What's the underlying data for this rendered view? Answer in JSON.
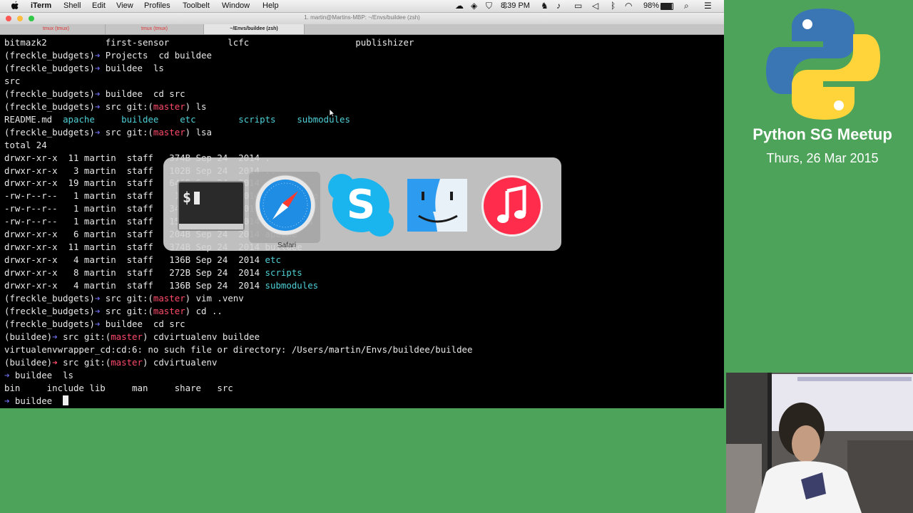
{
  "menubar": {
    "app_name": "iTerm",
    "menus": [
      "Shell",
      "Edit",
      "View",
      "Profiles",
      "Toolbelt",
      "Window",
      "Help"
    ],
    "time": "8:39 PM",
    "battery": "98%"
  },
  "window": {
    "title": "1. martin@Martins-MBP: ~/Envs/buildee (zsh)",
    "tabs": [
      "tmux (tmux)",
      "tmux (tmux)",
      "~/Envs/buildee (zsh)"
    ]
  },
  "terminal": {
    "lines": [
      [
        {
          "t": "bitmazk2           first-sensor           lcfc                    publishizer"
        }
      ],
      [
        {
          "t": "(freckle_budgets)"
        },
        {
          "t": "➜ ",
          "c": "c-arrow"
        },
        {
          "t": "Projects  cd buildee"
        }
      ],
      [
        {
          "t": "(freckle_budgets)"
        },
        {
          "t": "➜ ",
          "c": "c-arrow"
        },
        {
          "t": "buildee  ls"
        }
      ],
      [
        {
          "t": "src"
        }
      ],
      [
        {
          "t": "(freckle_budgets)"
        },
        {
          "t": "➜ ",
          "c": "c-arrow"
        },
        {
          "t": "buildee  cd src"
        }
      ],
      [
        {
          "t": "(freckle_budgets)"
        },
        {
          "t": "➜ ",
          "c": "c-arrow"
        },
        {
          "t": "src git:("
        },
        {
          "t": "master",
          "c": "c-red"
        },
        {
          "t": ") ls"
        }
      ],
      [
        {
          "t": "README.md  "
        },
        {
          "t": "apache",
          "c": "c-cyan"
        },
        {
          "t": "     "
        },
        {
          "t": "buildee",
          "c": "c-cyan"
        },
        {
          "t": "    "
        },
        {
          "t": "etc",
          "c": "c-cyan"
        },
        {
          "t": "        "
        },
        {
          "t": "scripts",
          "c": "c-cyan"
        },
        {
          "t": "    "
        },
        {
          "t": "submodules",
          "c": "c-cyan"
        }
      ],
      [
        {
          "t": "(freckle_budgets)"
        },
        {
          "t": "➜ ",
          "c": "c-arrow"
        },
        {
          "t": "src git:("
        },
        {
          "t": "master",
          "c": "c-red"
        },
        {
          "t": ") lsa"
        }
      ],
      [
        {
          "t": "total 24"
        }
      ],
      [
        {
          "t": "drwxr-xr-x  11 martin  staff   374B Sep 24  2014 ."
        }
      ],
      [
        {
          "t": "drwxr-xr-x   3 martin  staff   102B Sep 24  2014 .."
        }
      ],
      [
        {
          "t": "drwxr-xr-x  19 martin  staff   646B Sep 24  2014 .git"
        }
      ],
      [
        {
          "t": "-rw-r--r--   1 martin  staff    12B Sep 24  2014 .gitignore"
        }
      ],
      [
        {
          "t": "-rw-r--r--   1 martin  staff   340B Sep 24  2014 .venv"
        }
      ],
      [
        {
          "t": "-rw-r--r--   1 martin  staff   153B Sep 24  2014 README.md"
        }
      ],
      [
        {
          "t": "drwxr-xr-x   6 martin  staff   204B Sep 24  2014 apache"
        }
      ],
      [
        {
          "t": "drwxr-xr-x  11 martin  staff   374B Sep 24  2014 buildee"
        }
      ],
      [
        {
          "t": "drwxr-xr-x   4 martin  staff   136B Sep 24  2014 "
        },
        {
          "t": "etc",
          "c": "c-cyan"
        }
      ],
      [
        {
          "t": "drwxr-xr-x   8 martin  staff   272B Sep 24  2014 "
        },
        {
          "t": "scripts",
          "c": "c-cyan"
        }
      ],
      [
        {
          "t": "drwxr-xr-x   4 martin  staff   136B Sep 24  2014 "
        },
        {
          "t": "submodules",
          "c": "c-cyan"
        }
      ],
      [
        {
          "t": "(freckle_budgets)"
        },
        {
          "t": "➜ ",
          "c": "c-arrow"
        },
        {
          "t": "src git:("
        },
        {
          "t": "master",
          "c": "c-red"
        },
        {
          "t": ") vim .venv"
        }
      ],
      [
        {
          "t": "(freckle_budgets)"
        },
        {
          "t": "➜ ",
          "c": "c-arrow"
        },
        {
          "t": "src git:("
        },
        {
          "t": "master",
          "c": "c-red"
        },
        {
          "t": ") cd .."
        }
      ],
      [
        {
          "t": "(freckle_budgets)"
        },
        {
          "t": "➜ ",
          "c": "c-arrow"
        },
        {
          "t": "buildee  cd src"
        }
      ],
      [
        {
          "t": "(buildee)"
        },
        {
          "t": "➜ ",
          "c": "c-arrow"
        },
        {
          "t": "src git:("
        },
        {
          "t": "master",
          "c": "c-red"
        },
        {
          "t": ") cdvirtualenv buildee"
        }
      ],
      [
        {
          "t": "virtualenvwrapper_cd:cd:6: no such file or directory: /Users/martin/Envs/buildee/buildee"
        }
      ],
      [
        {
          "t": "(buildee)"
        },
        {
          "t": "➜ ",
          "c": "c-red"
        },
        {
          "t": "src git:("
        },
        {
          "t": "master",
          "c": "c-red"
        },
        {
          "t": ") cdvirtualenv"
        }
      ],
      [
        {
          "t": "➜ ",
          "c": "c-arrow"
        },
        {
          "t": "buildee  ls"
        }
      ],
      [
        {
          "t": "bin     include lib     man     share   src"
        }
      ],
      [
        {
          "t": "➜ ",
          "c": "c-arrow"
        },
        {
          "t": "buildee  "
        }
      ]
    ]
  },
  "switcher": {
    "apps": [
      {
        "name": "iTerm",
        "icon": "terminal-icon"
      },
      {
        "name": "Safari",
        "icon": "safari-icon"
      },
      {
        "name": "Skype",
        "icon": "skype-icon"
      },
      {
        "name": "Finder",
        "icon": "finder-icon"
      },
      {
        "name": "iTunes",
        "icon": "itunes-icon"
      }
    ],
    "selected_label": "Safari"
  },
  "panel": {
    "title": "Python SG Meetup",
    "date": "Thurs, 26 Mar 2015"
  }
}
